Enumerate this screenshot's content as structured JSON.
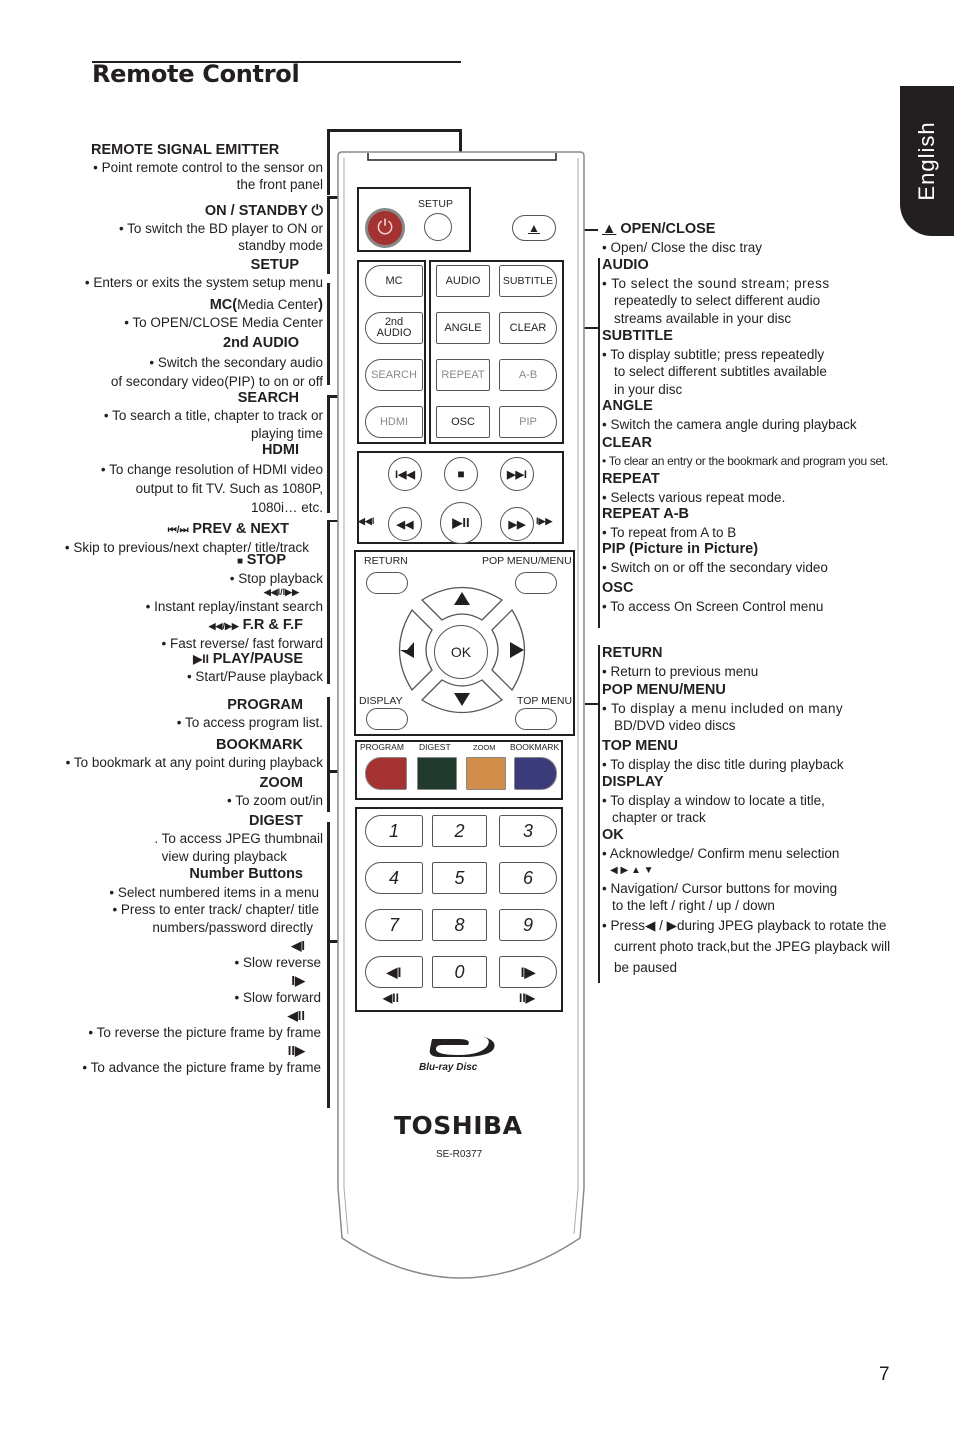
{
  "page": {
    "title": "Remote Control",
    "language_tab": "English",
    "page_number": "7"
  },
  "left_annotations": [
    {
      "heading": "REMOTE SIGNAL EMITTER",
      "lines": [
        "• Point remote control to the sensor on",
        "the front panel"
      ]
    },
    {
      "heading": "ON / STANDBY",
      "icon": "power-icon",
      "lines": [
        "• To switch the BD player to ON or",
        "standby mode"
      ]
    },
    {
      "heading": "SETUP",
      "lines": [
        "•   Enters or exits the system setup menu"
      ]
    },
    {
      "heading": "MC(",
      "heading_suffix": "Media Center",
      "heading_close": ")",
      "lines": [
        "• To OPEN/CLOSE Media Center"
      ]
    },
    {
      "heading": "2nd AUDIO",
      "lines": [
        "•   Switch the secondary audio",
        "of secondary video(PIP) to on or off"
      ]
    },
    {
      "heading": "SEARCH",
      "lines": [
        "• To search a title, chapter to track or",
        "playing time"
      ]
    },
    {
      "heading": "HDMI",
      "lines": [
        "• To change resolution of HDMI video",
        "output to fit TV. Such as 1080P,",
        "1080i… etc."
      ]
    },
    {
      "heading": "PREV & NEXT",
      "icon_text": "⏮/⏭",
      "lines": [
        "•  Skip to previous/next chapter/ title/track"
      ]
    },
    {
      "heading": "STOP",
      "icon_text": "■",
      "lines": [
        "• Stop playback"
      ]
    },
    {
      "heading": "",
      "icon_text": "◀◀I/I▶▶",
      "lines": [
        "•   Instant replay/instant search"
      ]
    },
    {
      "heading": "F.R & F.F",
      "icon_text": "◀◀/▶▶",
      "lines": [
        "•  Fast reverse/ fast forward"
      ]
    },
    {
      "heading": "PLAY/PAUSE",
      "icon_text": "▶II",
      "lines": [
        "• Start/Pause playback"
      ]
    },
    {
      "heading": "PROGRAM",
      "lines": [
        "• To access program list."
      ]
    },
    {
      "heading": "BOOKMARK",
      "lines": [
        "• To bookmark at any point during playback"
      ]
    },
    {
      "heading": "ZOOM",
      "lines": [
        "• To zoom out/in"
      ]
    },
    {
      "heading": "DIGEST",
      "lines": [
        ". To access JPEG thumbnail",
        "view during playback"
      ]
    },
    {
      "heading": "Number Buttons",
      "lines": [
        "•   Select numbered items in a menu",
        "•   Press to enter track/ chapter/ title",
        "numbers/password directly"
      ]
    },
    {
      "heading": "",
      "icon_text": "◀I",
      "lines": [
        "•   Slow reverse"
      ]
    },
    {
      "heading": "",
      "icon_text": "I▶",
      "lines": [
        "•   Slow forward"
      ]
    },
    {
      "heading": "",
      "icon_text": "◀II",
      "lines": [
        "•  To reverse the picture frame by frame"
      ]
    },
    {
      "heading": "",
      "icon_text": "II▶",
      "lines": [
        "•  To advance the picture frame by frame"
      ]
    }
  ],
  "right_annotations": [
    {
      "heading": "OPEN/CLOSE",
      "icon_text": "▲",
      "lines": [
        "•  Open/ Close the disc tray"
      ]
    },
    {
      "heading": "AUDIO",
      "lines": [
        "• To select the sound stream; press",
        "  repeatedly to select different audio",
        "  streams available in your disc"
      ]
    },
    {
      "heading": "SUBTITLE",
      "lines": [
        "• To display subtitle; press repeatedly",
        "  to select different subtitles available",
        "  in your disc"
      ]
    },
    {
      "heading": "ANGLE",
      "lines": [
        "•  Switch the camera angle during playback"
      ]
    },
    {
      "heading": "CLEAR",
      "lines": [
        "•  To clear an entry or the bookmark and program you set."
      ]
    },
    {
      "heading": "REPEAT",
      "lines": [
        "•  Selects various repeat mode."
      ]
    },
    {
      "heading": "REPEAT A-B",
      "lines": [
        "•  To repeat from A to B"
      ]
    },
    {
      "heading": "PIP (Picture in Picture)",
      "lines": [
        "•  Switch on or off the secondary video"
      ]
    },
    {
      "heading": "OSC",
      "lines": [
        "• To access On Screen Control menu"
      ]
    },
    {
      "heading": "RETURN",
      "lines": [
        "•  Return to previous menu"
      ]
    },
    {
      "heading": "POP MENU/MENU",
      "lines": [
        "•  To display a menu included on many",
        "   BD/DVD video discs"
      ]
    },
    {
      "heading": "TOP MENU",
      "lines": [
        "•  To display the disc title during playback"
      ]
    },
    {
      "heading": "DISPLAY",
      "lines": [
        "• To display a window to locate a title,",
        "  chapter or track"
      ]
    },
    {
      "heading": "OK",
      "lines": [
        "• Acknowledge/ Confirm menu selection",
        "  ◀ ▶ ▲ ▼",
        "• Navigation/ Cursor buttons for moving",
        "  to the left / right / up / down",
        "•  Press◀ / ▶during JPEG playback to rotate the",
        "   current photo track,but the JPEG playback will",
        "   be paused"
      ]
    }
  ],
  "remote": {
    "setup_label": "SETUP",
    "buttons_left": [
      "MC",
      "2nd\nAUDIO",
      "SEARCH",
      "HDMI"
    ],
    "buttons_mid": [
      "AUDIO",
      "ANGLE",
      "REPEAT",
      "OSC"
    ],
    "buttons_right": [
      "SUBTITLE",
      "CLEAR",
      "A-B",
      "PIP"
    ],
    "transport_icons": [
      "I◀◀",
      "■",
      "▶▶I",
      "◀◀",
      "▶II",
      "▶▶"
    ],
    "side_icons": [
      "◀◀I",
      "I▶▶"
    ],
    "nav_labels": {
      "return": "RETURN",
      "pop_menu": "POP MENU/MENU",
      "display": "DISPLAY",
      "top_menu": "TOP MENU",
      "ok": "OK"
    },
    "color_labels": [
      "PROGRAM",
      "DIGEST",
      "ZOOM",
      "BOOKMARK"
    ],
    "color_buttons": [
      "#a33231",
      "#213a2e",
      "#d18e4a",
      "#3a3b78"
    ],
    "numbers": [
      "1",
      "2",
      "3",
      "4",
      "5",
      "6",
      "7",
      "8",
      "9",
      "◀I",
      "0",
      "I▶"
    ],
    "frame_icons": [
      "◀II",
      "II▶"
    ],
    "bluray_logo": "Blu-ray Disc",
    "brand": "TOSHIBA",
    "model": "SE-R0377",
    "power_color": "#a33231"
  }
}
